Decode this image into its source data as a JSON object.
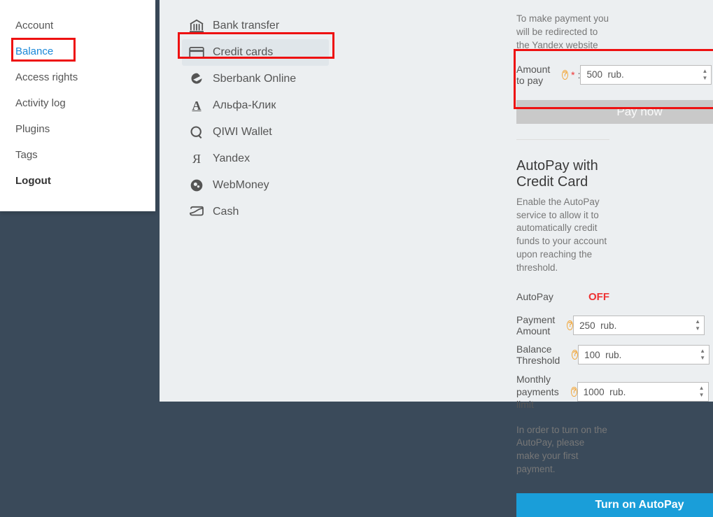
{
  "leftNav": {
    "items": [
      "Account",
      "Balance",
      "Access rights",
      "Activity log",
      "Plugins",
      "Tags",
      "Logout"
    ],
    "activeIndex": 1
  },
  "methods": [
    {
      "id": "bank-transfer",
      "label": "Bank transfer",
      "icon": "bank"
    },
    {
      "id": "credit-cards",
      "label": "Credit cards",
      "icon": "card"
    },
    {
      "id": "sberbank",
      "label": "Sberbank Online",
      "icon": "sber"
    },
    {
      "id": "alfa",
      "label": "Альфа-Клик",
      "icon": "alfa"
    },
    {
      "id": "qiwi",
      "label": "QIWI Wallet",
      "icon": "qiwi"
    },
    {
      "id": "yandex",
      "label": "Yandex",
      "icon": "ya"
    },
    {
      "id": "webmoney",
      "label": "WebMoney",
      "icon": "wm"
    },
    {
      "id": "cash",
      "label": "Cash",
      "icon": "cash"
    }
  ],
  "methodsActiveIndex": 1,
  "pay": {
    "redirectHint": "To make payment you will be redirected to the Yandex website",
    "amountLabel": "Amount to pay",
    "amountValue": "500  rub.",
    "payButton": "Pay now"
  },
  "autopay": {
    "title": "AutoPay with Credit Card",
    "desc": "Enable the AutoPay service to allow it to automatically credit funds to your account upon reaching the threshold.",
    "statusLabel": "AutoPay",
    "statusValue": "OFF",
    "paymentAmountLabel": "Payment Amount",
    "paymentAmountValue": "250  rub.",
    "thresholdLabel": "Balance Threshold",
    "thresholdValue": "100  rub.",
    "monthlyLabel": "Monthly payments limit",
    "monthlyValue": "1000  rub.",
    "note": "In order to turn on the AutoPay, please make your first payment.",
    "button": "Turn on AutoPay"
  }
}
